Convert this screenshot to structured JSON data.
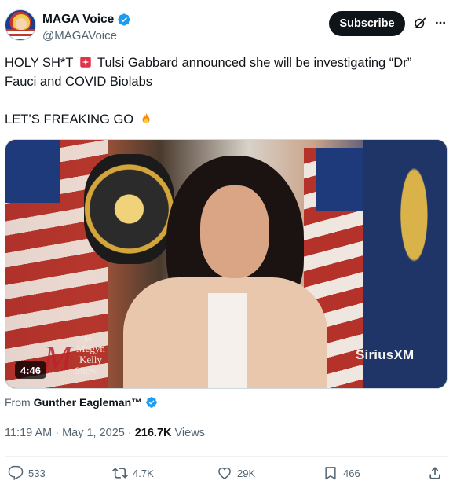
{
  "author": {
    "display_name": "MAGA Voice",
    "handle": "@MAGAVoice",
    "verified": true
  },
  "header": {
    "subscribe_label": "Subscribe",
    "grok_icon": "grok-icon",
    "more_icon": "more-icon"
  },
  "tweet": {
    "line1_a": "HOLY SH*T",
    "line1_emoji": "rotating-light-emoji",
    "line1_b": "Tulsi Gabbard announced she will be investigating “Dr” Fauci and COVID Biolabs",
    "line2": "LET’S FREAKING GO",
    "line2_emoji": "fire-emoji"
  },
  "media": {
    "duration": "4:46",
    "watermark_left": {
      "the": "The",
      "line1": "Megyn",
      "line2": "Kelly",
      "line3": "Show"
    },
    "watermark_right": "SiriusXM"
  },
  "attribution": {
    "prefix": "From",
    "name": "Gunther Eagleman™"
  },
  "meta": {
    "time": "11:19 AM · May 1, 2025 ·",
    "views_count": "216.7K",
    "views_label": "Views"
  },
  "actions": {
    "replies": "533",
    "reposts": "4.7K",
    "likes": "29K",
    "bookmarks": "466"
  },
  "colors": {
    "text_primary": "#0f1419",
    "text_secondary": "#536471",
    "verified_blue": "#1d9bf0",
    "subscribe_bg": "#0f1419"
  }
}
